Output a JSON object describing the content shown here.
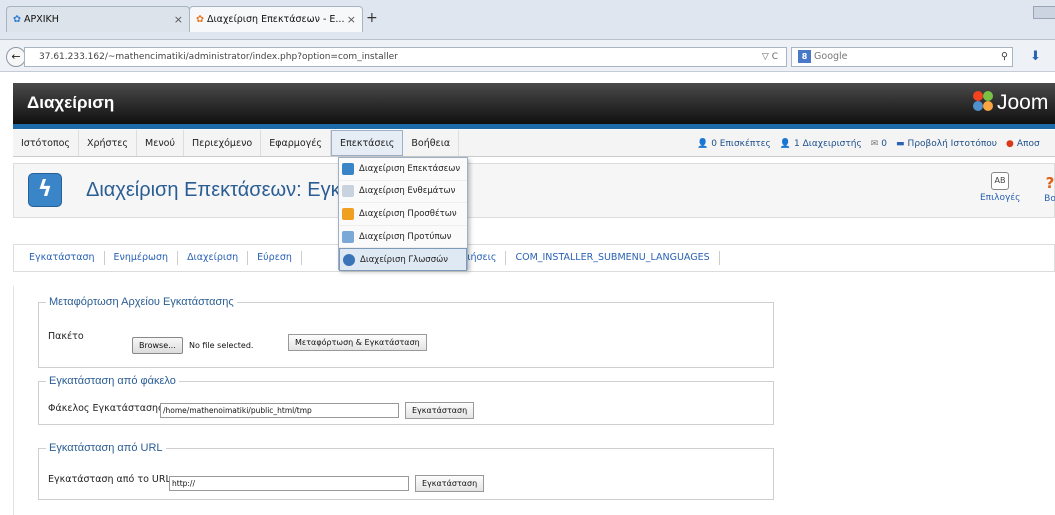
{
  "browser": {
    "tabs": [
      {
        "label": "ΑΡΧΙΚΗ",
        "close": "×"
      },
      {
        "label": "Διαχείριση Επεκτάσεων - Ε...",
        "close": "×"
      }
    ],
    "new_tab": "+",
    "url": "37.61.233.162/~mathencimatiki/administrator/index.php?option=com_installer",
    "url_controls": "▽ C",
    "search_placeholder": "Google",
    "search_engine": "8"
  },
  "header": {
    "title": "Διαχείριση",
    "logo_text": "Joom"
  },
  "menu": {
    "items": [
      "Ιστότοπος",
      "Χρήστες",
      "Μενού",
      "Περιεχόμενο",
      "Εφαρμογές",
      "Επεκτάσεις",
      "Βοήθεια"
    ],
    "open_index": 5
  },
  "status": {
    "visitors": "0 Επισκέπτες",
    "admins": "1 Διαχειριστής",
    "messages": "0",
    "view_site": "Προβολή Ιστοτόπου",
    "logout": "Αποσ"
  },
  "dropdown": {
    "items": [
      "Διαχείριση Επεκτάσεων",
      "Διαχείριση Ενθεμάτων",
      "Διαχείριση Προσθέτων",
      "Διαχείριση Προτύπων",
      "Διαχείριση Γλωσσών"
    ],
    "highlight_index": 4
  },
  "toolbar": {
    "title": "Διαχείριση Επεκτάσεων: Εγκα",
    "options_label": "Επιλογές",
    "help_label": "Βο"
  },
  "submenu": {
    "items": [
      "Εγκατάσταση",
      "Ενημέρωση",
      "Διαχείριση",
      "Εύρεση",
      "",
      "ιδοποιήσεις",
      "COM_INSTALLER_SUBMENU_LANGUAGES"
    ]
  },
  "upload_section": {
    "legend": "Μεταφόρτωση Αρχείου Εγκατάστασης",
    "label": "Πακέτο",
    "browse": "Browse...",
    "file_status": "No file selected.",
    "submit": "Μεταφόρτωση & Εγκατάσταση"
  },
  "folder_section": {
    "legend": "Εγκατάσταση από φάκελο",
    "label": "Φάκελος Εγκατάστασης",
    "value": "/home/mathenoimatiki/public_html/tmp",
    "submit": "Εγκατάσταση"
  },
  "url_section": {
    "legend": "Εγκατάσταση από URL",
    "label": "Εγκατάσταση από το URL",
    "value": "http://",
    "submit": "Εγκατάσταση"
  },
  "colors": {
    "accent_blue": "#1b6ca8",
    "link": "#2a62b5",
    "header_dark": "#101010"
  }
}
